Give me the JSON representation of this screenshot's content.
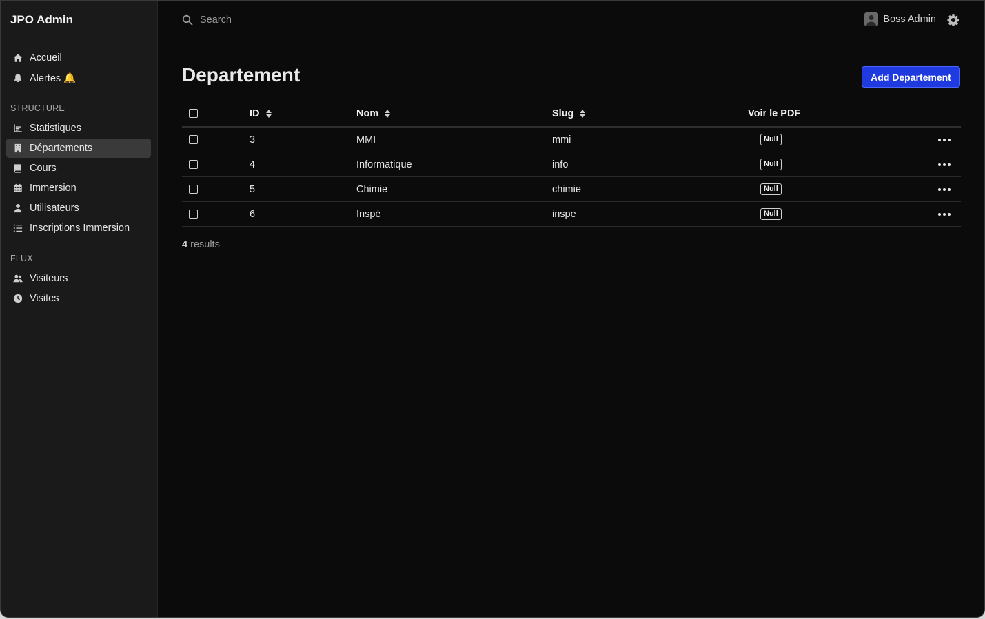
{
  "app": {
    "title": "JPO Admin"
  },
  "sidebar": {
    "items": [
      {
        "label": "Accueil",
        "icon": "home-icon"
      },
      {
        "label": "Alertes 🔔",
        "icon": "bell-icon"
      }
    ],
    "structure_label": "STRUCTURE",
    "structure_items": [
      {
        "label": "Statistiques",
        "icon": "chart-icon"
      },
      {
        "label": "Départements",
        "icon": "building-icon",
        "active": true
      },
      {
        "label": "Cours",
        "icon": "book-icon"
      },
      {
        "label": "Immersion",
        "icon": "calendar-icon"
      },
      {
        "label": "Utilisateurs",
        "icon": "user-icon"
      },
      {
        "label": "Inscriptions Immersion",
        "icon": "list-icon"
      }
    ],
    "flux_label": "FLUX",
    "flux_items": [
      {
        "label": "Visiteurs",
        "icon": "users-icon"
      },
      {
        "label": "Visites",
        "icon": "clock-icon"
      }
    ]
  },
  "header": {
    "search_placeholder": "Search",
    "user_name": "Boss Admin"
  },
  "main": {
    "title": "Departement",
    "add_button": "Add Departement",
    "columns": {
      "id": "ID",
      "nom": "Nom",
      "slug": "Slug",
      "pdf": "Voir le PDF"
    },
    "rows": [
      {
        "id": "3",
        "nom": "MMI",
        "slug": "mmi",
        "pdf": "Null"
      },
      {
        "id": "4",
        "nom": "Informatique",
        "slug": "info",
        "pdf": "Null"
      },
      {
        "id": "5",
        "nom": "Chimie",
        "slug": "chimie",
        "pdf": "Null"
      },
      {
        "id": "6",
        "nom": "Inspé",
        "slug": "inspe",
        "pdf": "Null"
      }
    ],
    "results_count": "4",
    "results_label": "results"
  },
  "colors": {
    "accent": "#1f3be0",
    "background": "#0b0b0b",
    "sidebar": "#1a1a1a"
  }
}
